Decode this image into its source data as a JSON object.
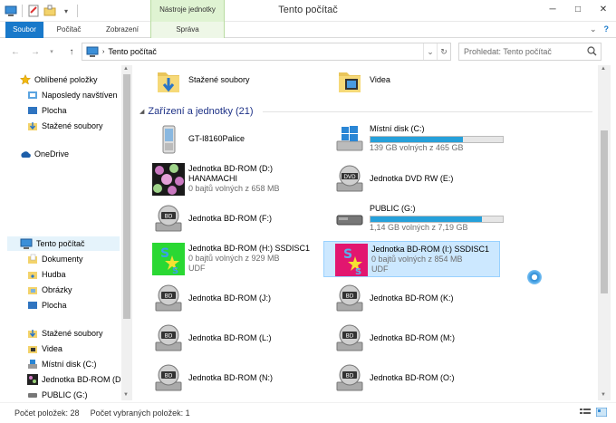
{
  "window": {
    "title": "Tento počítač",
    "contextual_group": "Nástroje jednotky"
  },
  "ribbon": {
    "tabs": [
      "Soubor",
      "Počítač",
      "Zobrazení",
      "Správa"
    ]
  },
  "address": {
    "path": "Tento počítač",
    "search_placeholder": "Prohledat: Tento počítač"
  },
  "nav": {
    "favorites_title": "Oblíbené položky",
    "favorites": [
      "Naposledy navštíven",
      "Plocha",
      "Stažené soubory"
    ],
    "onedrive": "OneDrive",
    "this_pc": "Tento počítač",
    "pc_items": [
      "Dokumenty",
      "Hudba",
      "Obrázky",
      "Plocha"
    ],
    "pc_items2": [
      "Stažené soubory",
      "Videa",
      "Místní disk (C:)",
      "Jednotka BD-ROM (D",
      "PUBLIC (G:)"
    ]
  },
  "folders": [
    {
      "name": "Stažené soubory",
      "icon": "downloads-folder-icon"
    },
    {
      "name": "Videa",
      "icon": "videos-folder-icon"
    }
  ],
  "devices_group": "Zařízení a jednotky (21)",
  "devices": [
    {
      "name": "GT-I8160Palice",
      "sub": "",
      "sub2": "",
      "icon": "phone-icon"
    },
    {
      "name": "Místní disk (C:)",
      "sub": "139 GB volných z 465 GB",
      "sub2": "",
      "icon": "windows-disk-icon",
      "used_fraction": 0.7
    },
    {
      "name": "Jednotka BD-ROM (D:)",
      "name2": "HANAMACHI",
      "sub": "0 bajtů volných z 658 MB",
      "sub2": "",
      "icon": "disc-art-icon"
    },
    {
      "name": "Jednotka DVD RW (E:)",
      "sub": "",
      "sub2": "",
      "icon": "dvd-drive-icon"
    },
    {
      "name": "Jednotka BD-ROM (F:)",
      "sub": "",
      "sub2": "",
      "icon": "bd-drive-icon"
    },
    {
      "name": "PUBLIC (G:)",
      "sub": "1,14 GB volných z 7,19 GB",
      "sub2": "",
      "icon": "usb-drive-icon",
      "used_fraction": 0.84
    },
    {
      "name": "Jednotka BD-ROM (H:) SSDISC1",
      "sub": "0 bajtů volných z 929 MB",
      "sub2": "UDF",
      "icon": "disc-art-green-icon"
    },
    {
      "name": "Jednotka BD-ROM (I:) SSDISC1",
      "sub": "0 bajtů volných z 854 MB",
      "sub2": "UDF",
      "icon": "disc-art-pink-icon"
    },
    {
      "name": "Jednotka BD-ROM (J:)",
      "sub": "",
      "sub2": "",
      "icon": "bd-drive-icon"
    },
    {
      "name": "Jednotka BD-ROM (K:)",
      "sub": "",
      "sub2": "",
      "icon": "bd-drive-icon"
    },
    {
      "name": "Jednotka BD-ROM (L:)",
      "sub": "",
      "sub2": "",
      "icon": "bd-drive-icon"
    },
    {
      "name": "Jednotka BD-ROM (M:)",
      "sub": "",
      "sub2": "",
      "icon": "bd-drive-icon"
    },
    {
      "name": "Jednotka BD-ROM (N:)",
      "sub": "",
      "sub2": "",
      "icon": "bd-drive-icon"
    },
    {
      "name": "Jednotka BD-ROM (O:)",
      "sub": "",
      "sub2": "",
      "icon": "bd-drive-icon"
    }
  ],
  "status": {
    "items": "Počet položek: 28",
    "selected": "Počet vybraných položek: 1"
  },
  "colors": {
    "accent": "#1979ca",
    "bar_fill": "#26a0da",
    "selection": "#cce8ff"
  }
}
